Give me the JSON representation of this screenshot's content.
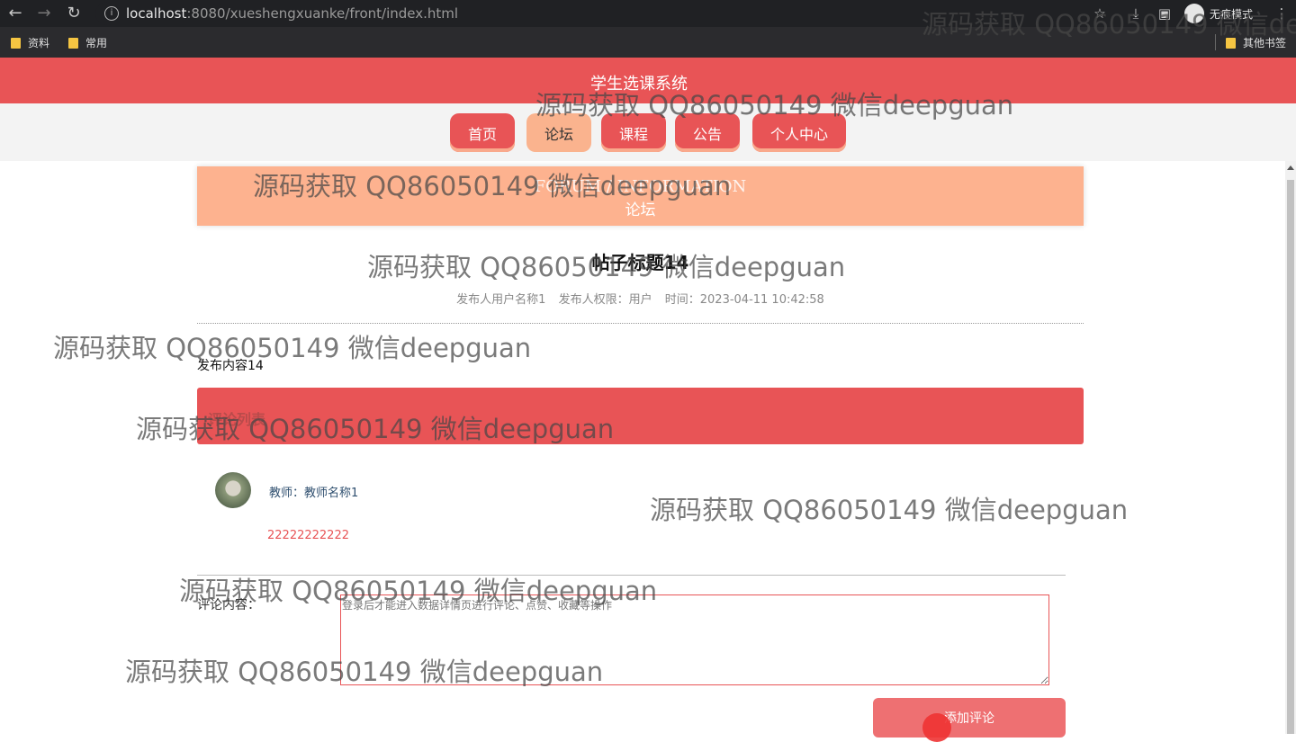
{
  "browser": {
    "url_host": "localhost",
    "url_rest": ":8080/xueshengxuanke/front/index.html",
    "incognito_label": "无痕模式",
    "bookmarks": [
      "资料",
      "常用"
    ],
    "other_bookmarks": "其他书签"
  },
  "site": {
    "title": "学生选课系统",
    "nav": [
      "首页",
      "论坛",
      "课程",
      "公告",
      "个人中心"
    ],
    "active_nav": "论坛"
  },
  "banner": {
    "en": "FORUM / INFORMATION",
    "cn": "论坛"
  },
  "post": {
    "title": "帖子标题14",
    "author": "发布人用户名称1",
    "role": "发布人权限：用户",
    "time": "时间：2023-04-11 10:42:58",
    "content": "发布内容14"
  },
  "comments": {
    "header": "评论列表",
    "items": [
      {
        "author": "教师：教师名称1",
        "text": "22222222222"
      }
    ]
  },
  "form": {
    "label": "评论内容：",
    "placeholder": "登录后才能进入数据详情页进行评论、点赞、收藏等操作",
    "submit": "添加评论"
  },
  "watermark": "源码获取 QQ86050149 微信deepguan",
  "colors": {
    "primary": "#e85456",
    "accent": "#fdb28f",
    "button": "#ee7072"
  }
}
